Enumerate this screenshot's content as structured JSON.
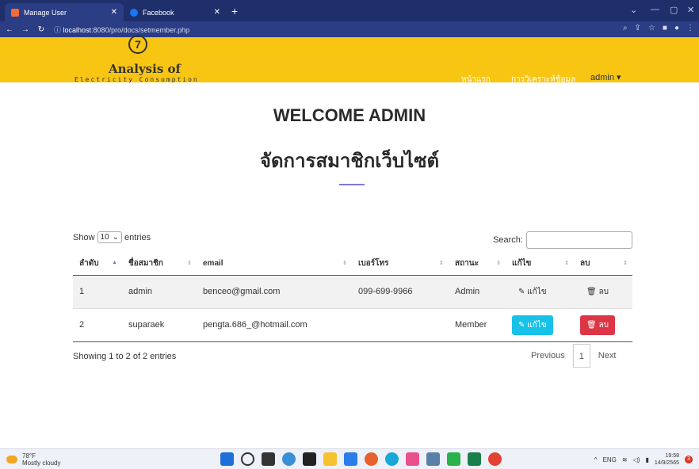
{
  "browser": {
    "tabs": [
      {
        "title": "Manage User",
        "favicon_color": "#f26b3a"
      },
      {
        "title": "Facebook",
        "favicon_color": "#1877f2"
      }
    ],
    "url_host": "localhost",
    "url_rest": ":8080/pro/docs/setmember.php"
  },
  "site": {
    "logo_mark": "7",
    "logo_title": "Analysis of",
    "logo_subtitle": "Electricity Consumption",
    "nav": {
      "home": "หน้าแรก",
      "analysis": "การวิเคราะห์ข้อมูล",
      "user": "admin ▾"
    }
  },
  "main": {
    "welcome": "WELCOME ADMIN",
    "subtitle": "จัดการสมาชิกเว็บไซต์",
    "show_label": "Show",
    "entries_value": "10",
    "entries_label": "entries",
    "search_label": "Search:",
    "columns": [
      "ลำดับ",
      "ชื่อสมาชิก",
      "email",
      "เบอร์โทร",
      "สถานะ",
      "แก้ไข",
      "ลบ"
    ],
    "rows": [
      {
        "no": "1",
        "name": "admin",
        "email": "benceo@gmail.com",
        "phone": "099-699-9966",
        "status": "Admin",
        "edit": "แก้ไข",
        "del": "ลบ"
      },
      {
        "no": "2",
        "name": "suparaek",
        "email": "pengta.686_@hotmail.com",
        "phone": "",
        "status": "Member",
        "edit": "แก้ไข",
        "del": "ลบ"
      }
    ],
    "info": "Showing 1 to 2 of 2 entries",
    "pager": {
      "prev": "Previous",
      "page": "1",
      "next": "Next"
    }
  },
  "taskbar": {
    "temp": "78°F",
    "weather": "Mostly cloudy",
    "lang": "ENG",
    "time": "19:58",
    "date": "14/9/2565",
    "notif_count": "3"
  }
}
